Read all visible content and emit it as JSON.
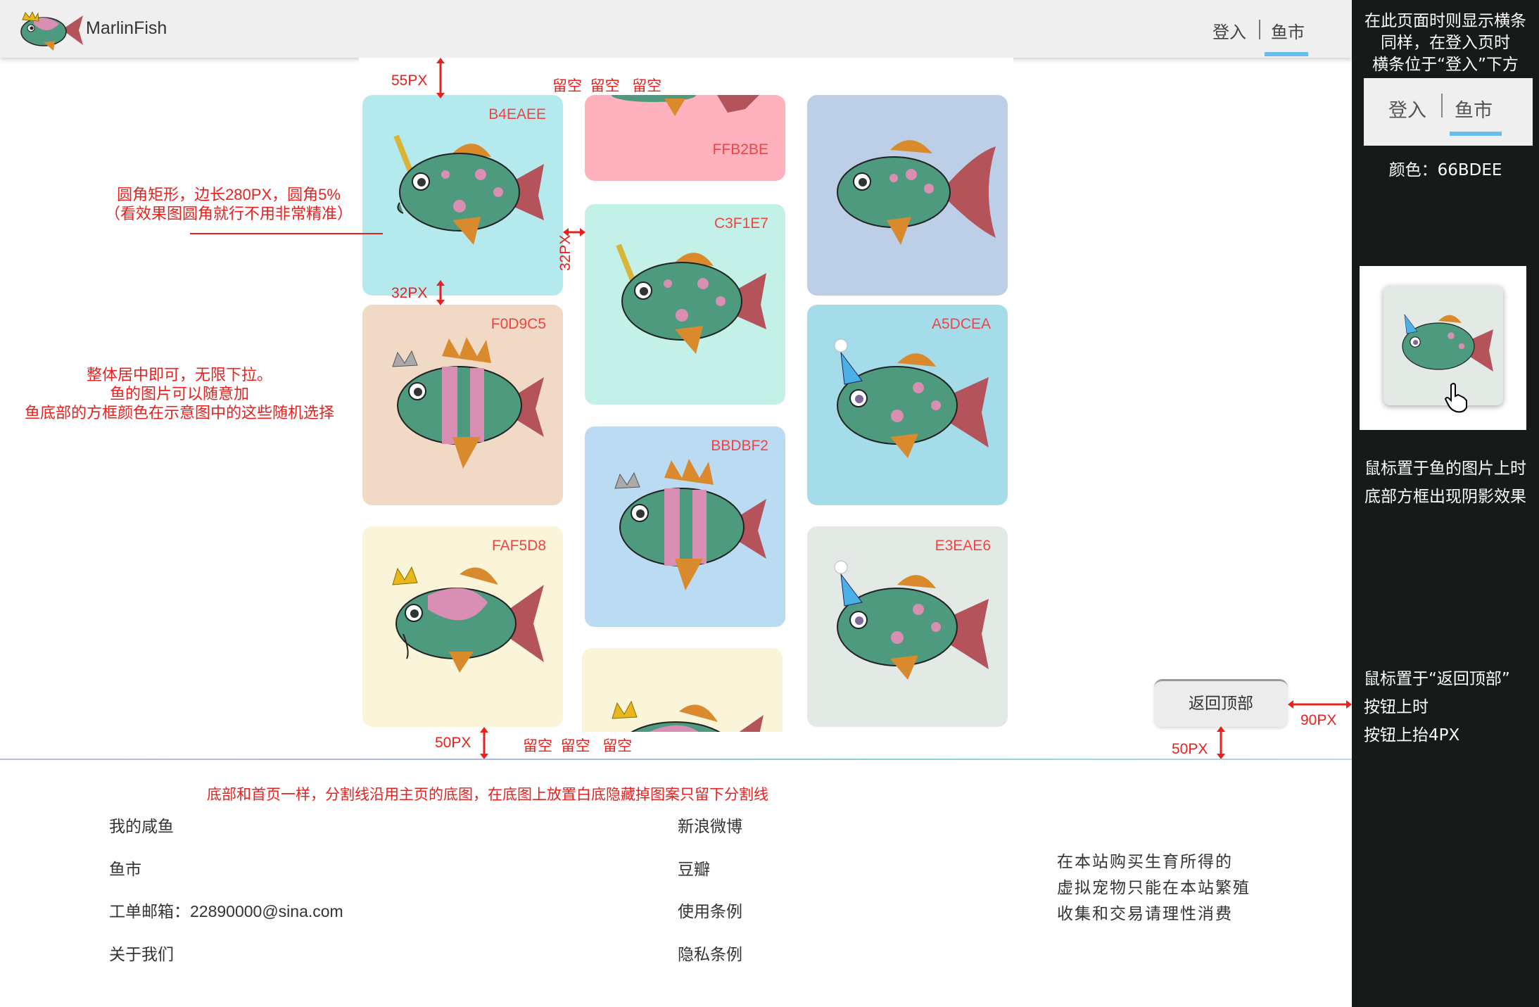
{
  "header": {
    "brand": "MarlinFish",
    "nav_login": "登入",
    "nav_market": "鱼市",
    "accent_color": "#66BDEE"
  },
  "cards": [
    {
      "code": "B4EAEE",
      "color": "#B4EAEE",
      "fish": "narwhal"
    },
    {
      "code": "FFB2BE",
      "color": "#FFB2BE",
      "fish": "partial"
    },
    {
      "code": "",
      "color": "#BDCFE7",
      "fish": "plain"
    },
    {
      "code": "F0D9C5",
      "color": "#F0D9C5",
      "fish": "crown-striped"
    },
    {
      "code": "C3F1E7",
      "color": "#C3F1E7",
      "fish": "narwhal"
    },
    {
      "code": "A5DCEA",
      "color": "#A5DCEA",
      "fish": "party"
    },
    {
      "code": "BBDBF2",
      "color": "#BBDBF2",
      "fish": "crown-striped"
    },
    {
      "code": "FAF5D8",
      "color": "#FAF5D8",
      "fish": "crown"
    },
    {
      "code": "E3EAE6",
      "color": "#E3EAE6",
      "fish": "party"
    },
    {
      "code": "",
      "color": "#FAF5D8",
      "fish": "crown-partial"
    }
  ],
  "annotations": {
    "top_gap": "55PX",
    "top_space": [
      "留空",
      "留空",
      "留空"
    ],
    "card_spec_line1": "圆角矩形，边长280PX，圆角5%",
    "card_spec_line2": "（看效果图圆角就行不用非常精准）",
    "gap_horizontal": "32PX",
    "gap_vertical": "32PX",
    "layout_line1": "整体居中即可，无限下拉。",
    "layout_line2": "鱼的图片可以随意加",
    "layout_line3": "鱼底部的方框颜色在示意图中的这些随机选择",
    "bottom_gap": "50PX",
    "bottom_space": [
      "留空",
      "留空",
      "留空"
    ],
    "footer_note": "底部和首页一样，分割线沿用主页的底图，在底图上放置白底隐藏掉图案只留下分割线",
    "back_top_right_gap": "90PX",
    "back_top_bottom_gap": "50PX"
  },
  "right_panel": {
    "note_line1": "在此页面时则显示横条",
    "note_line2": "同样，在登入页时",
    "note_line3": "横条位于“登入”下方",
    "demo_login": "登入",
    "demo_market": "鱼市",
    "color_label": "颜色：66BDEE",
    "hover_line1": "鼠标置于鱼的图片上时",
    "hover_line2": "底部方框出现阴影效果",
    "back_line1": "鼠标置于“返回顶部”",
    "back_line2": "按钮上时",
    "back_line3": "按钮上抬4PX"
  },
  "back_to_top": "返回顶部",
  "footer": {
    "col1": [
      "我的咸鱼",
      "鱼市",
      "工单邮箱：22890000@sina.com",
      "关于我们"
    ],
    "col2": [
      "新浪微博",
      "豆瓣",
      "使用条例",
      "隐私条例"
    ],
    "notice": [
      "在本站购买生育所得的",
      "虚拟宠物只能在本站繁殖",
      "收集和交易请理性消费"
    ]
  }
}
